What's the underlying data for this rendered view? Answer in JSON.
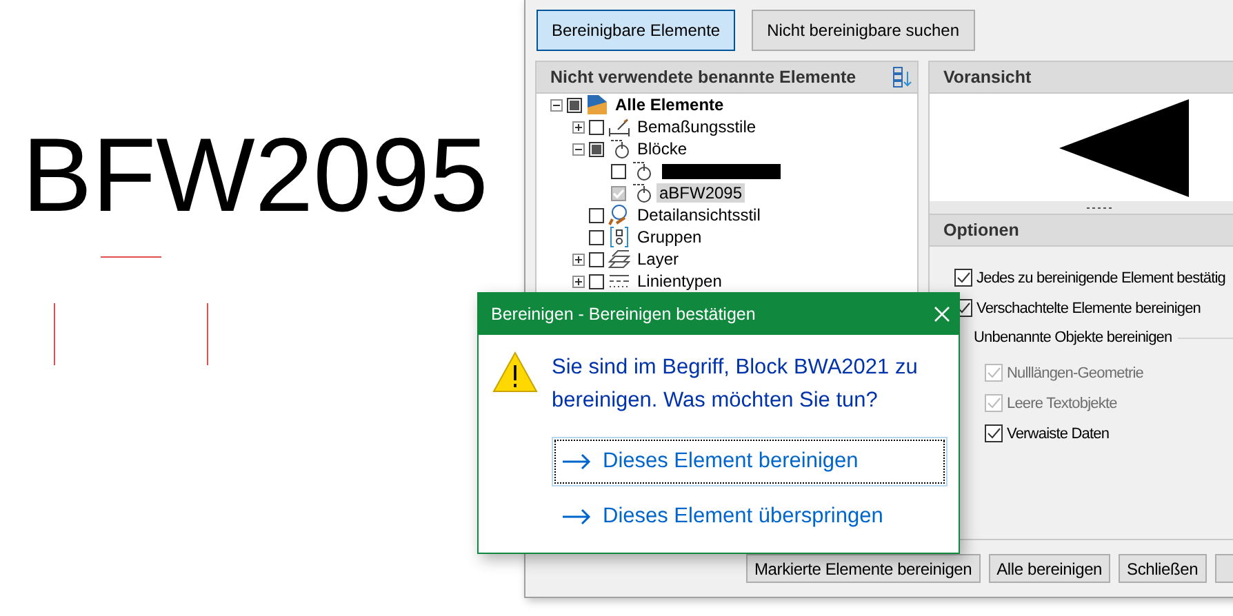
{
  "canvas": {
    "label": "BFW2095"
  },
  "window": {
    "top_buttons": [
      {
        "label": "Bereinigbare Elemente",
        "selected": true
      },
      {
        "label": "Nicht bereinigbare suchen",
        "selected": false
      }
    ],
    "tree_panel": {
      "title": "Nicht verwendete benannte Elemente",
      "nodes": [
        {
          "label": "Alle Elemente",
          "kind": "all",
          "checked": false,
          "partial": true,
          "expanded": true,
          "selected": false,
          "children": [
            {
              "label": "Bemaßungsstile",
              "kind": "dimension",
              "checked": false,
              "partial": false,
              "expanded": false,
              "selected": false
            },
            {
              "label": "Blöcke",
              "kind": "block",
              "checked": false,
              "partial": true,
              "expanded": true,
              "selected": false,
              "children": [
                {
                  "kind": "block",
                  "checked": false,
                  "partial": false,
                  "redacted": true
                },
                {
                  "label": "aBFW2095",
                  "kind": "block",
                  "checked": true,
                  "partial": false,
                  "selected": true
                }
              ]
            },
            {
              "label": "Detailansichtsstil",
              "kind": "detail",
              "checked": false,
              "partial": false,
              "selected": false
            },
            {
              "label": "Gruppen",
              "kind": "group",
              "checked": false,
              "partial": false,
              "selected": false
            },
            {
              "label": "Layer",
              "kind": "layer",
              "checked": false,
              "partial": false,
              "expanded": false,
              "selected": false
            },
            {
              "label": "Linientypen",
              "kind": "linetype",
              "checked": false,
              "partial": false,
              "expanded": false,
              "selected": false
            }
          ]
        }
      ]
    },
    "preview": {
      "title": "Voransicht"
    },
    "options": {
      "title": "Optionen",
      "items": [
        {
          "kind": "checkbox",
          "label": "Jedes zu bereinigende Element bestätig",
          "checked": true,
          "disabled": false
        },
        {
          "kind": "checkbox",
          "label": "Verschachtelte Elemente bereinigen",
          "checked": true,
          "disabled": false
        },
        {
          "kind": "group",
          "label": "Unbenannte Objekte bereinigen",
          "items": [
            {
              "kind": "checkbox",
              "label": "Nulllängen-Geometrie",
              "checked": true,
              "disabled": true
            },
            {
              "kind": "checkbox",
              "label": "Leere Textobjekte",
              "checked": true,
              "disabled": true
            },
            {
              "kind": "checkbox",
              "label": "Verwaiste Daten",
              "checked": true,
              "disabled": false
            }
          ]
        }
      ]
    },
    "bottom_buttons": [
      {
        "label": "Markierte Elemente bereinigen"
      },
      {
        "label": "Alle bereinigen"
      },
      {
        "label": "Schließen"
      }
    ]
  },
  "dialog": {
    "title": "Bereinigen - Bereinigen bestätigen",
    "message": "Sie sind im Begriff, Block BWA2021 zu bereinigen. Was möchten Sie tun?",
    "commands": [
      {
        "label": "Dieses Element bereinigen",
        "selected": true
      },
      {
        "label": "Dieses Element überspringen",
        "selected": false
      }
    ]
  }
}
